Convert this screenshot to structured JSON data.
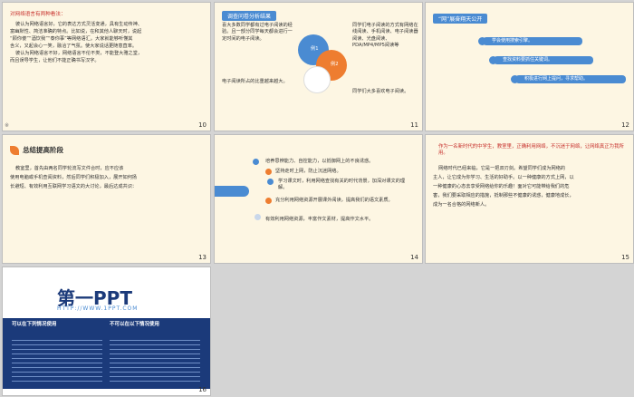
{
  "slides": [
    {
      "num": "10",
      "title": "对网络语言有两种看法：",
      "lines": [
        "彼认为网络语言好，它的表达方式灵活变通，具有生动传神、",
        "富幽默性、简洁准确的特点。比如说，在和其他人聊天时，说起",
        "“顾你傻”“酒饮我”“泰你事”等网络语汇。大家就能够听懂其",
        "含义，又起会心一笑，融洽了气氛。使大家说话更随意直率。",
        "彼认为网络语言不好，网络语言不伦不类，不能登大雅之堂，",
        "而且误导学生，让他们不能正确书写汉字。"
      ]
    },
    {
      "num": "11",
      "title": "调查问卷分析结果",
      "left": [
        "喜大多数同学都有过电子阅读的经验。且一部分同学每天都会进行一定时间的电子阅读。",
        "电子阅读所占的比重越来越大。"
      ],
      "right": [
        "同学们电子阅读的方式有网络在线阅读、手机阅读、电子阅读器阅读、光盘阅读、PDA/MP4/MP5阅读等",
        "同学们大多喜欢电子阅读。"
      ],
      "pie": [
        "例1",
        "例2"
      ]
    },
    {
      "num": "12",
      "title": "“网”展奋翔天公开",
      "items": [
        "学会使用搜索引擎。",
        "查找资料要抓住关键词。",
        "积极进行网上提问，寻求帮助。"
      ]
    },
    {
      "num": "13",
      "title": "总结提高阶段",
      "lines": [
        "教室里，首先由两名同学轮流写文件合时，应不应该",
        "使用电脑或手机查阅资料，然后同学们积极加入，展开如何扬",
        "长避短、有效利用互联网学习语文的大讨论，最后达成共识："
      ]
    },
    {
      "num": "14",
      "items": [
        "培养思辨能力、自控能力，以抵御网上的不良诱惑。",
        "坚持走时上网，防止沉迷网络。",
        "学习课文时，利用网络查找有关的时代背景，加深对课文的理解。",
        "充分利用网络资源开展课外阅读，提高我们的语文素质。",
        "有效利用网络资源，丰富作文素材，提高作文水平。"
      ]
    },
    {
      "num": "15",
      "title": "作为一名新时代的中学生，教室里，正确利用网络，不沉迷于网络，让网络真正为我所用。",
      "lines": [
        "网络时代已经来临，它是一把双刃剑。希望同学们成为网络的",
        "主人，让它成为你学习、生活的好助手。以一种健康的方式上网，以",
        "一种健康的心态去享受网络给你的乐趣！面对它可能带给我们的危",
        "害，我们要采取相应的措施，抵制那些不健康的诱惑，健康地成长，",
        "成为一名合格的网络新人。"
      ]
    },
    {
      "num": "16",
      "brand": "第一PPT",
      "url": "HTTP://WWW.1PPT.COM",
      "col1": "可以在下列情况使用",
      "col2": "不可以在以下情况使用"
    }
  ],
  "colors": {
    "blue": "#4a8bd2",
    "orange": "#ee7d30",
    "red": "#c7302c",
    "dark": "#333333",
    "navy": "#1b3a7a"
  }
}
